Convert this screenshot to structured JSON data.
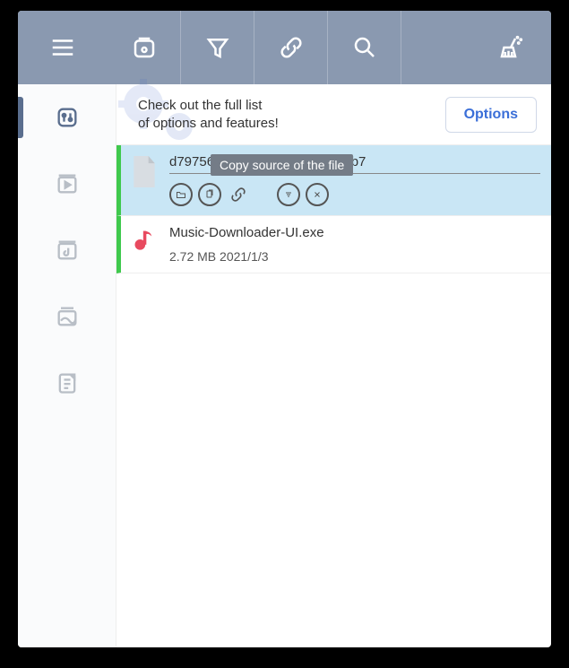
{
  "banner": {
    "text_line1": "Check out the full list",
    "text_line2": "of options and features!",
    "options_label": "Options"
  },
  "tooltip": "Copy source of the file",
  "items": [
    {
      "title": "d79756               c75240ca97a429800bb7",
      "type": "doc"
    },
    {
      "title": "Music-Downloader-UI.exe",
      "size": "2.72 MB",
      "date": "2021/1/3",
      "type": "music"
    }
  ]
}
